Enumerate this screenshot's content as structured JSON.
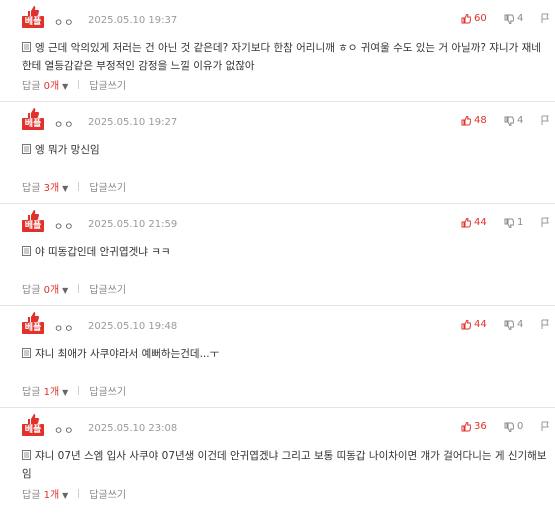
{
  "comments": [
    {
      "badge": "베플",
      "nick": "ㅇㅇ",
      "date": "2025.05.10 19:37",
      "up": "60",
      "down": "4",
      "text": "엥 근데 악의있게 저러는 건 아닌 것 같은데? 자기보다 한참 어리니깨 ㅎㅇ 귀여울 수도 있는 거 아닐까? 쟈니가 재네한테 열등감같은 부정적인 감정을 느낄 이유가 없잖아",
      "reply_label": "답글",
      "reply_count": "0개",
      "write_label": "답글쓰기"
    },
    {
      "badge": "베플",
      "nick": "ㅇㅇ",
      "date": "2025.05.10 19:27",
      "up": "48",
      "down": "4",
      "text": "엥 뭐가 망신임",
      "reply_label": "답글",
      "reply_count": "3개",
      "write_label": "답글쓰기"
    },
    {
      "badge": "베플",
      "nick": "ㅇㅇ",
      "date": "2025.05.10 21:59",
      "up": "44",
      "down": "1",
      "text": "야 띠동갑인데 안귀엽겟냐 ㅋㅋ",
      "reply_label": "답글",
      "reply_count": "0개",
      "write_label": "답글쓰기"
    },
    {
      "badge": "베플",
      "nick": "ㅇㅇ",
      "date": "2025.05.10 19:48",
      "up": "44",
      "down": "4",
      "text": "쟈니 최애가 사쿠야라서 예뻐하는건데...ㅜ",
      "reply_label": "답글",
      "reply_count": "1개",
      "write_label": "답글쓰기"
    },
    {
      "badge": "베플",
      "nick": "ㅇㅇ",
      "date": "2025.05.10 23:08",
      "up": "36",
      "down": "0",
      "text": "쟈니 07년 스엠 입사 사쿠야 07년생 이건데 안귀엽겠냐 그리고 보통 띠동갑 나이차이면 걔가 걸어다니는 게 신기해보임",
      "reply_label": "답글",
      "reply_count": "1개",
      "write_label": "답글쓰기"
    }
  ],
  "colors": {
    "accent": "#e0322b",
    "muted": "#9a9a9a",
    "divider": "#e6e6e6"
  },
  "icons": {
    "badge": "thumbs-up-badge-icon",
    "up": "thumbs-up-icon",
    "down": "thumbs-down-icon",
    "report": "report-flag-icon",
    "doc": "document-icon",
    "caret": "chevron-down-icon"
  }
}
